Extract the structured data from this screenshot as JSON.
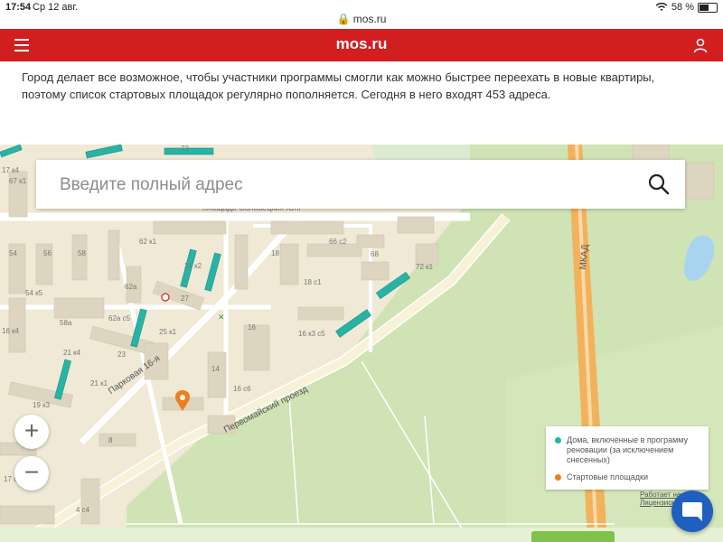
{
  "status": {
    "time": "17:54",
    "date": "Ср 12 авг.",
    "battery": "58 %",
    "battery_level": 0.58,
    "url": "mos.ru"
  },
  "header": {
    "logo": "mos.ru",
    "menu_icon": "hamburger-icon",
    "user_icon": "user-icon",
    "color": "#d11f1f"
  },
  "intro": {
    "text": "Город делает все возможное, чтобы участники программы смогли как можно быстрее переехать в новые квартиры, поэтому список стартовых площадок регулярно пополняется. Сегодня в него входят 453 адреса."
  },
  "search": {
    "placeholder": "Введите полный адрес",
    "icon": "search-icon"
  },
  "map": {
    "zoom_in": "+",
    "zoom_out": "−",
    "street_labels": {
      "park": "Парковая 16-я",
      "pervomaysky": "Первомайский проезд",
      "mkad": "МКАД",
      "square": "площадь Соловецких Юнг"
    },
    "house_numbers": [
      "67 к1",
      "62 к1",
      "54",
      "56",
      "58",
      "54 к5",
      "58а",
      "62а",
      "62а с5",
      "21 к2",
      "21 к4",
      "21 к1",
      "23",
      "25 к1",
      "27",
      "19 к3",
      "16 к4",
      "16",
      "14",
      "16 с6",
      "16 к3 с5",
      "17 к4",
      "18",
      "18 с1",
      "66 с2",
      "68",
      "72 к1",
      "4 с4",
      "17 с6",
      "8",
      "72"
    ]
  },
  "legend": {
    "items": [
      {
        "label": "Дома, включенные в программу реновации (за исключением снесенных)",
        "color": "#27b3a5"
      },
      {
        "label": "Стартовые площадки",
        "color": "#ef7d1a"
      }
    ]
  },
  "attribution": {
    "line1": "Работает на",
    "line2": "Лицензионное"
  },
  "chat": {
    "icon": "chat-icon",
    "color": "#1f5fc0"
  }
}
